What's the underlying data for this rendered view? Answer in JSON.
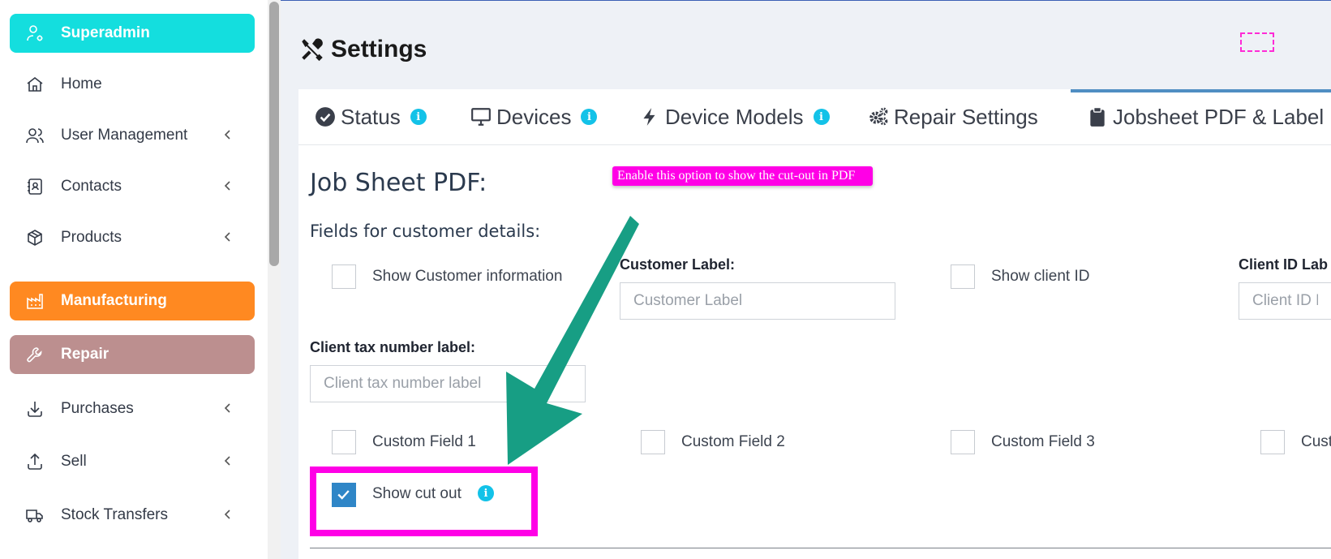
{
  "sidebar": {
    "items": [
      {
        "label": "Superadmin",
        "icon": "user-cog-icon",
        "bg": "#14dede",
        "has_chevron": false
      },
      {
        "label": "Home",
        "icon": "home-icon",
        "has_chevron": false
      },
      {
        "label": "User Management",
        "icon": "users-icon",
        "has_chevron": true
      },
      {
        "label": "Contacts",
        "icon": "address-book-icon",
        "has_chevron": true
      },
      {
        "label": "Products",
        "icon": "box-icon",
        "has_chevron": true
      },
      {
        "label": "Manufacturing",
        "icon": "factory-icon",
        "bg": "#ff8921",
        "has_chevron": false
      },
      {
        "label": "Repair",
        "icon": "wrench-icon",
        "bg": "#bc8f8f",
        "has_chevron": false
      },
      {
        "label": "Purchases",
        "icon": "download-icon",
        "has_chevron": true
      },
      {
        "label": "Sell",
        "icon": "upload-icon",
        "has_chevron": true
      },
      {
        "label": "Stock Transfers",
        "icon": "truck-icon",
        "has_chevron": true
      }
    ]
  },
  "header": {
    "title": "Settings",
    "icon": "tools-icon"
  },
  "tabs": [
    {
      "label": "Status",
      "icon": "check-circle-icon",
      "info": true
    },
    {
      "label": "Devices",
      "icon": "desktop-icon",
      "info": true
    },
    {
      "label": "Device Models",
      "icon": "bolt-icon",
      "info": true
    },
    {
      "label": "Repair Settings",
      "icon": "cogs-icon",
      "info": false
    },
    {
      "label": "Jobsheet PDF & Label",
      "icon": "clipboard-icon",
      "info": false,
      "active": true
    }
  ],
  "tooltip": {
    "text": "Enable this option to show the cut-out in PDF"
  },
  "jobsheet": {
    "section_title": "Job Sheet PDF:",
    "subhead": "Fields for customer details:",
    "show_customer_info": "Show Customer information",
    "customer_label": {
      "label": "Customer Label:",
      "placeholder": "Customer Label"
    },
    "show_client_id": "Show client ID",
    "client_id_label": {
      "label": "Client ID Lab",
      "placeholder": "Client ID La"
    },
    "client_tax_label": {
      "label": "Client tax number label:",
      "placeholder": "Client tax number label"
    },
    "custom_fields": [
      "Custom Field 1",
      "Custom Field 2",
      "Custom Field 3",
      "Cust"
    ],
    "show_cut_out": {
      "label": "Show cut out",
      "checked": true
    }
  },
  "colors": {
    "accent": "#13c2e8",
    "annotation": "#ff00e6",
    "arrow": "#179e84",
    "checkbox": "#2f86c7"
  }
}
